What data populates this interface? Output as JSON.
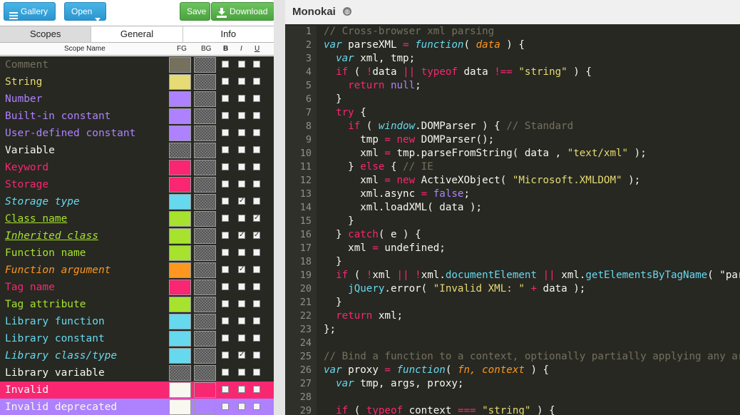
{
  "toolbar": {
    "gallery_label": "Gallery",
    "open_label": "Open",
    "save_label": "Save",
    "download_label": "Download"
  },
  "tabs": [
    {
      "label": "Scopes",
      "active": true
    },
    {
      "label": "General",
      "active": false
    },
    {
      "label": "Info",
      "active": false
    }
  ],
  "columns": {
    "name": "Scope Name",
    "fg": "FG",
    "bg": "BG",
    "bold": "B",
    "italic": "I",
    "underline": "U"
  },
  "scopes": [
    {
      "name": "Comment",
      "fg": "#75715e",
      "bg": null,
      "b": false,
      "i": false,
      "u": false
    },
    {
      "name": "String",
      "fg": "#e6db74",
      "bg": null,
      "b": false,
      "i": false,
      "u": false
    },
    {
      "name": "Number",
      "fg": "#ae81ff",
      "bg": null,
      "b": false,
      "i": false,
      "u": false
    },
    {
      "name": "Built-in constant",
      "fg": "#ae81ff",
      "bg": null,
      "b": false,
      "i": false,
      "u": false
    },
    {
      "name": "User-defined constant",
      "fg": "#ae81ff",
      "bg": null,
      "b": false,
      "i": false,
      "u": false
    },
    {
      "name": "Variable",
      "fg": null,
      "bg": null,
      "b": false,
      "i": false,
      "u": false
    },
    {
      "name": "Keyword",
      "fg": "#f92672",
      "bg": null,
      "b": false,
      "i": false,
      "u": false
    },
    {
      "name": "Storage",
      "fg": "#f92672",
      "bg": null,
      "b": false,
      "i": false,
      "u": false
    },
    {
      "name": "Storage type",
      "fg": "#66d9ef",
      "bg": null,
      "b": false,
      "i": true,
      "u": false
    },
    {
      "name": "Class name",
      "fg": "#a6e22e",
      "bg": null,
      "b": false,
      "i": false,
      "u": true
    },
    {
      "name": "Inherited class",
      "fg": "#a6e22e",
      "bg": null,
      "b": false,
      "i": true,
      "u": true
    },
    {
      "name": "Function name",
      "fg": "#a6e22e",
      "bg": null,
      "b": false,
      "i": false,
      "u": false
    },
    {
      "name": "Function argument",
      "fg": "#fd971f",
      "bg": null,
      "b": false,
      "i": true,
      "u": false
    },
    {
      "name": "Tag name",
      "fg": "#f92672",
      "bg": null,
      "b": false,
      "i": false,
      "u": false
    },
    {
      "name": "Tag attribute",
      "fg": "#a6e22e",
      "bg": null,
      "b": false,
      "i": false,
      "u": false
    },
    {
      "name": "Library function",
      "fg": "#66d9ef",
      "bg": null,
      "b": false,
      "i": false,
      "u": false
    },
    {
      "name": "Library constant",
      "fg": "#66d9ef",
      "bg": null,
      "b": false,
      "i": false,
      "u": false
    },
    {
      "name": "Library class/type",
      "fg": "#66d9ef",
      "bg": null,
      "b": false,
      "i": true,
      "u": false
    },
    {
      "name": "Library variable",
      "fg": null,
      "bg": null,
      "b": false,
      "i": false,
      "u": false
    },
    {
      "name": "Invalid",
      "fg": "#f8f8f0",
      "bg": "#f92672",
      "b": false,
      "i": false,
      "u": false
    },
    {
      "name": "Invalid deprecated",
      "fg": "#f8f8f0",
      "bg": "#ae81ff",
      "b": false,
      "i": false,
      "u": false
    }
  ],
  "editor": {
    "theme_name": "Monokai",
    "colors": {
      "comment": "#75715e",
      "string": "#e6db74",
      "keyword": "#f92672",
      "storage": "#66d9ef",
      "function": "#a6e22e",
      "argument": "#fd971f",
      "constant": "#ae81ff",
      "text": "#f8f8f2"
    },
    "lines": [
      {
        "n": "1",
        "s": [
          [
            "c",
            "// Cross-browser xml parsing"
          ]
        ]
      },
      {
        "n": "2",
        "s": [
          [
            "s",
            "var"
          ],
          [
            "p",
            " parseXML "
          ],
          [
            "k",
            "="
          ],
          [
            "p",
            " "
          ],
          [
            "s",
            "function"
          ],
          [
            "p",
            "( "
          ],
          [
            "a",
            "data"
          ],
          [
            "p",
            " ) {"
          ]
        ]
      },
      {
        "n": "3",
        "s": [
          [
            "p",
            "  "
          ],
          [
            "s",
            "var"
          ],
          [
            "p",
            " xml, tmp;"
          ]
        ]
      },
      {
        "n": "4",
        "s": [
          [
            "p",
            "  "
          ],
          [
            "k",
            "if"
          ],
          [
            "p",
            " ( "
          ],
          [
            "k",
            "!"
          ],
          [
            "p",
            "data "
          ],
          [
            "k",
            "||"
          ],
          [
            "p",
            " "
          ],
          [
            "k",
            "typeof"
          ],
          [
            "p",
            " data "
          ],
          [
            "k",
            "!=="
          ],
          [
            "p",
            " "
          ],
          [
            "t",
            "\"string\""
          ],
          [
            "p",
            " ) {"
          ]
        ]
      },
      {
        "n": "5",
        "s": [
          [
            "p",
            "    "
          ],
          [
            "k",
            "return"
          ],
          [
            "p",
            " "
          ],
          [
            "n",
            "null"
          ],
          [
            "p",
            ";"
          ]
        ]
      },
      {
        "n": "6",
        "s": [
          [
            "p",
            "  }"
          ]
        ]
      },
      {
        "n": "7",
        "s": [
          [
            "p",
            "  "
          ],
          [
            "k",
            "try"
          ],
          [
            "p",
            " {"
          ]
        ]
      },
      {
        "n": "8",
        "s": [
          [
            "p",
            "    "
          ],
          [
            "k",
            "if"
          ],
          [
            "p",
            " ( "
          ],
          [
            "l",
            "window"
          ],
          [
            "p",
            ".DOMParser ) { "
          ],
          [
            "c",
            "// Standard"
          ]
        ]
      },
      {
        "n": "9",
        "s": [
          [
            "p",
            "      tmp "
          ],
          [
            "k",
            "="
          ],
          [
            "p",
            " "
          ],
          [
            "k",
            "new"
          ],
          [
            "p",
            " DOMParser();"
          ]
        ]
      },
      {
        "n": "10",
        "s": [
          [
            "p",
            "      xml "
          ],
          [
            "k",
            "="
          ],
          [
            "p",
            " tmp.parseFromString( data , "
          ],
          [
            "t",
            "\"text/xml\""
          ],
          [
            "p",
            " );"
          ]
        ]
      },
      {
        "n": "11",
        "s": [
          [
            "p",
            "    } "
          ],
          [
            "k",
            "else"
          ],
          [
            "p",
            " { "
          ],
          [
            "c",
            "// IE"
          ]
        ]
      },
      {
        "n": "12",
        "s": [
          [
            "p",
            "      xml "
          ],
          [
            "k",
            "="
          ],
          [
            "p",
            " "
          ],
          [
            "k",
            "new"
          ],
          [
            "p",
            " ActiveXObject( "
          ],
          [
            "t",
            "\"Microsoft.XMLDOM\""
          ],
          [
            "p",
            " );"
          ]
        ]
      },
      {
        "n": "13",
        "s": [
          [
            "p",
            "      xml.async "
          ],
          [
            "k",
            "="
          ],
          [
            "p",
            " "
          ],
          [
            "n",
            "false"
          ],
          [
            "p",
            ";"
          ]
        ]
      },
      {
        "n": "14",
        "s": [
          [
            "p",
            "      xml.loadXML( data );"
          ]
        ]
      },
      {
        "n": "15",
        "s": [
          [
            "p",
            "    }"
          ]
        ]
      },
      {
        "n": "16",
        "s": [
          [
            "p",
            "  } "
          ],
          [
            "k",
            "catch"
          ],
          [
            "p",
            "( e ) {"
          ]
        ]
      },
      {
        "n": "17",
        "s": [
          [
            "p",
            "    xml "
          ],
          [
            "k",
            "="
          ],
          [
            "p",
            " undefined;"
          ]
        ]
      },
      {
        "n": "18",
        "s": [
          [
            "p",
            "  }"
          ]
        ]
      },
      {
        "n": "19",
        "s": [
          [
            "p",
            "  "
          ],
          [
            "k",
            "if"
          ],
          [
            "p",
            " ( "
          ],
          [
            "k",
            "!"
          ],
          [
            "p",
            "xml "
          ],
          [
            "k",
            "||"
          ],
          [
            "p",
            " "
          ],
          [
            "k",
            "!"
          ],
          [
            "p",
            "xml."
          ],
          [
            "m",
            "documentElement"
          ],
          [
            "p",
            " "
          ],
          [
            "k",
            "||"
          ],
          [
            "p",
            " xml."
          ],
          [
            "m",
            "getElementsByTagName"
          ],
          [
            "p",
            "( \"parsererror\" ).length ) {"
          ]
        ]
      },
      {
        "n": "20",
        "s": [
          [
            "p",
            "    "
          ],
          [
            "m",
            "jQuery"
          ],
          [
            "p",
            ".error( "
          ],
          [
            "t",
            "\"Invalid XML: \""
          ],
          [
            "p",
            " "
          ],
          [
            "k",
            "+"
          ],
          [
            "p",
            " data );"
          ]
        ]
      },
      {
        "n": "21",
        "s": [
          [
            "p",
            "  }"
          ]
        ]
      },
      {
        "n": "22",
        "s": [
          [
            "p",
            "  "
          ],
          [
            "k",
            "return"
          ],
          [
            "p",
            " xml;"
          ]
        ]
      },
      {
        "n": "23",
        "s": [
          [
            "p",
            "};"
          ]
        ]
      },
      {
        "n": "24",
        "s": []
      },
      {
        "n": "25",
        "s": [
          [
            "c",
            "// Bind a function to a context, optionally partially applying any arguments."
          ]
        ]
      },
      {
        "n": "26",
        "s": [
          [
            "s",
            "var"
          ],
          [
            "p",
            " proxy "
          ],
          [
            "k",
            "="
          ],
          [
            "p",
            " "
          ],
          [
            "s",
            "function"
          ],
          [
            "p",
            "( "
          ],
          [
            "a",
            "fn, context"
          ],
          [
            "p",
            " ) {"
          ]
        ]
      },
      {
        "n": "27",
        "s": [
          [
            "p",
            "  "
          ],
          [
            "s",
            "var"
          ],
          [
            "p",
            " tmp, args, proxy;"
          ]
        ]
      },
      {
        "n": "28",
        "s": []
      },
      {
        "n": "29",
        "s": [
          [
            "p",
            "  "
          ],
          [
            "k",
            "if"
          ],
          [
            "p",
            " ( "
          ],
          [
            "k",
            "typeof"
          ],
          [
            "p",
            " context "
          ],
          [
            "k",
            "==="
          ],
          [
            "p",
            " "
          ],
          [
            "t",
            "\"string\""
          ],
          [
            "p",
            " ) {"
          ]
        ]
      }
    ]
  }
}
